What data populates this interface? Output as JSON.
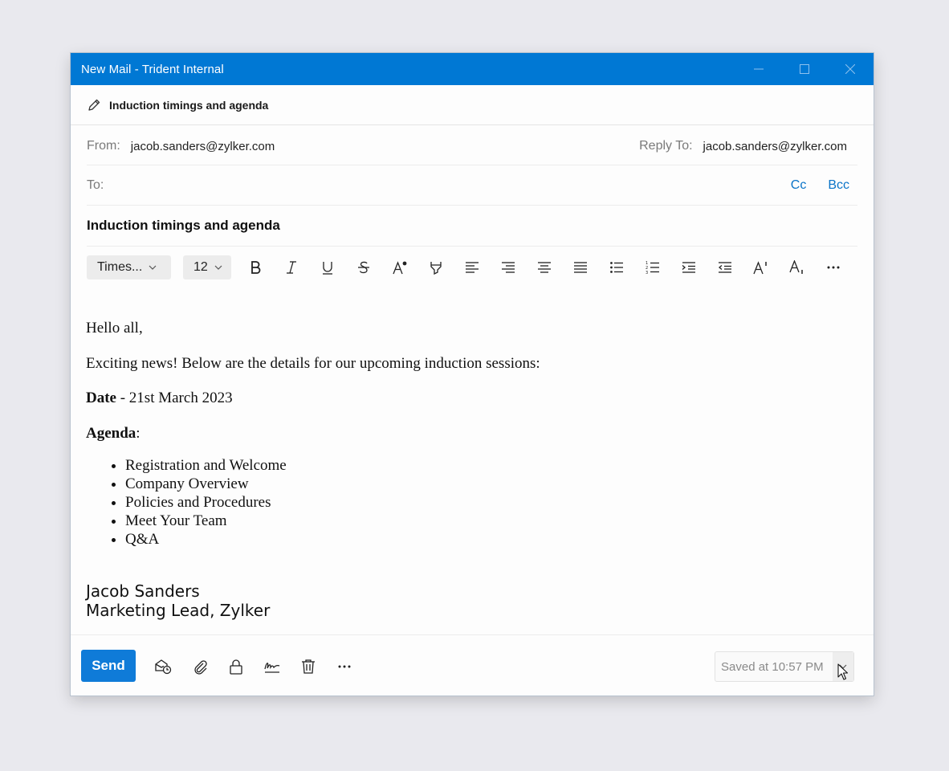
{
  "window": {
    "title": "New Mail - Trident Internal"
  },
  "subject_bar": {
    "text": "Induction timings and agenda"
  },
  "from": {
    "label": "From:",
    "value": "jacob.sanders@zylker.com"
  },
  "reply_to": {
    "label": "Reply To:",
    "value": "jacob.sanders@zylker.com"
  },
  "to": {
    "label": "To:",
    "value": ""
  },
  "cc_label": "Cc",
  "bcc_label": "Bcc",
  "subject": "Induction timings and agenda",
  "format_toolbar": {
    "font_family": "Times...",
    "font_size": "12",
    "buttons": [
      "bold-icon",
      "italic-icon",
      "underline-icon",
      "strikethrough-icon",
      "font-color-icon",
      "highlight-icon",
      "align-left-icon",
      "align-right-icon",
      "align-center-icon",
      "justify-icon",
      "bullet-list-icon",
      "numbered-list-icon",
      "indent-icon",
      "outdent-icon",
      "superscript-icon",
      "subscript-icon",
      "more-icon"
    ]
  },
  "body": {
    "greeting": "Hello all,",
    "intro": "Exciting news! Below are the details for our upcoming induction sessions:",
    "date_label": "Date",
    "date_value": " - 21st March 2023",
    "agenda_label": "Agenda",
    "agenda_colon": ":",
    "agenda_items": [
      "Registration and Welcome",
      "Company Overview",
      "Policies and Procedures",
      "Meet Your Team",
      "Q&A"
    ],
    "signature_name": "Jacob Sanders",
    "signature_title": "Marketing Lead, Zylker"
  },
  "footer": {
    "send_label": "Send",
    "saved_text": "Saved at 10:57 PM",
    "buttons": [
      "schedule-send-icon",
      "attachment-icon",
      "lock-icon",
      "signature-icon",
      "delete-icon",
      "more-icon"
    ]
  },
  "colors": {
    "accent": "#0078d4",
    "link": "#0a74c8",
    "send": "#0f7bd8"
  }
}
